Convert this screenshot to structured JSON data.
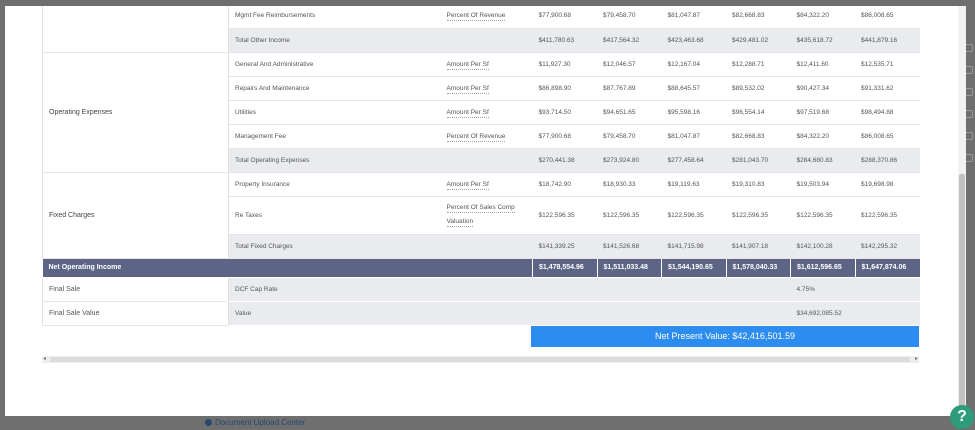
{
  "background": {
    "link_label": "Document Upload Center"
  },
  "colors": {
    "header": "#5d6587",
    "npv": "#2d8cf0",
    "help": "#2c9c7a"
  },
  "rows": {
    "mgmt_fee_reimb": {
      "item": "Mgmt Fee Reimbursements",
      "method": "Percent Of Revenue",
      "values": [
        "$77,900.68",
        "$79,458.70",
        "$81,047.87",
        "$82,668.83",
        "$84,322.20",
        "$86,008.65"
      ]
    },
    "total_other_income": {
      "item": "Total Other Income",
      "values": [
        "$411,780.63",
        "$417,564.32",
        "$423,463.68",
        "$429,481.02",
        "$435,618.72",
        "$441,879.16"
      ]
    },
    "operating_expenses": {
      "category": "Operating Expenses",
      "items": [
        {
          "item": "General And Administrative",
          "method": "Amount Per Sf",
          "values": [
            "$11,927.30",
            "$12,046.57",
            "$12,167.04",
            "$12,288.71",
            "$12,411.60",
            "$12,535.71"
          ]
        },
        {
          "item": "Repairs And Maintenance",
          "method": "Amount Per Sf",
          "values": [
            "$86,898.90",
            "$87,767.89",
            "$88,645.57",
            "$89,532.02",
            "$90,427.34",
            "$91,331.62"
          ]
        },
        {
          "item": "Utilities",
          "method": "Amount Per Sf",
          "values": [
            "$93,714.50",
            "$94,651.65",
            "$95,598.16",
            "$96,554.14",
            "$97,519.68",
            "$98,494.88"
          ]
        },
        {
          "item": "Management Fee",
          "method": "Percent Of Revenue",
          "values": [
            "$77,900.68",
            "$79,458.70",
            "$81,047.87",
            "$82,668.83",
            "$84,322.20",
            "$86,008.65"
          ]
        }
      ],
      "total": {
        "item": "Total Operating Expenses",
        "values": [
          "$270,441.38",
          "$273,924.80",
          "$277,458.64",
          "$281,043.70",
          "$284,680.83",
          "$288,370.86"
        ]
      }
    },
    "fixed_charges": {
      "category": "Fixed Charges",
      "items": [
        {
          "item": "Property Insurance",
          "method": "Amount Per Sf",
          "values": [
            "$18,742.90",
            "$18,930.33",
            "$19,119.63",
            "$19,310.83",
            "$19,503.94",
            "$19,698.98"
          ]
        },
        {
          "item": "Re Taxes",
          "method": "Percent Of Sales Comp Valuation",
          "values": [
            "$122,596.35",
            "$122,596.35",
            "$122,596.35",
            "$122,596.35",
            "$122,596.35",
            "$122,596.35"
          ]
        }
      ],
      "total": {
        "item": "Total Fixed Charges",
        "values": [
          "$141,339.25",
          "$141,526.68",
          "$141,715.98",
          "$141,907.18",
          "$142,100.28",
          "$142,295.32"
        ]
      }
    },
    "noi": {
      "label": "Net Operating Income",
      "values": [
        "$1,478,554.96",
        "$1,511,033.48",
        "$1,544,190.65",
        "$1,578,040.33",
        "$1,612,596.65",
        "$1,647,874.06"
      ]
    },
    "final_sale": {
      "category": "Final Sale",
      "item": "DCF Cap Rate",
      "value": "4.75%"
    },
    "final_sale_value": {
      "category": "Final Sale Value",
      "item": "Value",
      "value": "$34,692,085.52"
    }
  },
  "npv": {
    "label": "Net Present Value: $42,416,501.59"
  },
  "help": {
    "label": "?"
  }
}
